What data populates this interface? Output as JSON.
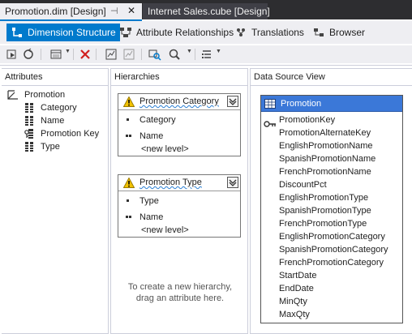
{
  "document_tabs": [
    {
      "title": "Promotion.dim [Design]",
      "active": true
    },
    {
      "title": "Internet Sales.cube [Design]",
      "active": false
    }
  ],
  "designer_tabs": [
    {
      "label": "Dimension Structure",
      "icon": "dimension-structure-icon",
      "active": true
    },
    {
      "label": "Attribute Relationships",
      "icon": "attribute-relationships-icon",
      "active": false
    },
    {
      "label": "Translations",
      "icon": "translations-icon",
      "active": false
    },
    {
      "label": "Browser",
      "icon": "browser-icon",
      "active": false
    }
  ],
  "toolbar": {
    "icons": [
      "process-icon",
      "reconnect-icon",
      "view-icon",
      "delete-icon",
      "new-named-calc-icon",
      "new-named-query-icon",
      "find-table-icon",
      "zoom-icon",
      "show-icon"
    ]
  },
  "attributes": {
    "title": "Attributes",
    "root": "Promotion",
    "items": [
      "Category",
      "Name",
      "Promotion Key",
      "Type"
    ]
  },
  "hierarchies": {
    "title": "Hierarchies",
    "boxes": [
      {
        "name": "Promotion Category",
        "levels": [
          "Category",
          "Name"
        ],
        "new_level": "<new level>"
      },
      {
        "name": "Promotion Type",
        "levels": [
          "Type",
          "Name"
        ],
        "new_level": "<new level>"
      }
    ],
    "hint_line1": "To create a new hierarchy,",
    "hint_line2": "drag an attribute here."
  },
  "dsv": {
    "title": "Data Source View",
    "table_name": "Promotion",
    "columns": [
      "PromotionKey",
      "PromotionAlternateKey",
      "EnglishPromotionName",
      "SpanishPromotionName",
      "FrenchPromotionName",
      "DiscountPct",
      "EnglishPromotionType",
      "SpanishPromotionType",
      "FrenchPromotionType",
      "EnglishPromotionCategory",
      "SpanishPromotionCategory",
      "FrenchPromotionCategory",
      "StartDate",
      "EndDate",
      "MinQty",
      "MaxQty"
    ]
  },
  "colors": {
    "accent": "#007acc",
    "tab_strip": "#2d2d30",
    "dsv_header": "#3b78d8",
    "warning": "#f2c200"
  }
}
